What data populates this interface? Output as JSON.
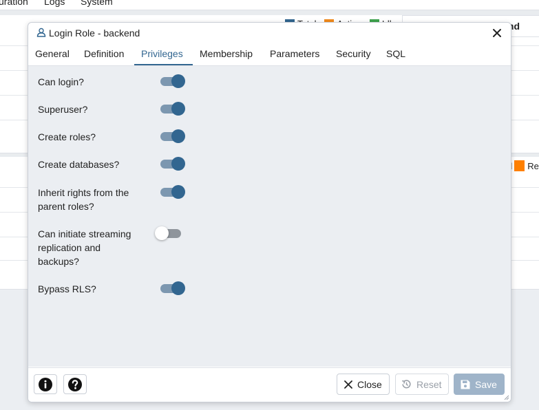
{
  "background": {
    "menu": [
      "uration",
      "Logs",
      "System"
    ],
    "legend_top": [
      {
        "label": "Total",
        "color": "#326690"
      },
      {
        "label": "Active",
        "color": "#f28a1c"
      },
      {
        "label": "Idle",
        "color": "#3fa34d"
      }
    ],
    "panel_title_suffix": "nd",
    "legend_mid": [
      {
        "label": "d",
        "color": ""
      },
      {
        "label": "Re",
        "color": "#ff8000"
      }
    ]
  },
  "dialog": {
    "title": "Login Role - backend",
    "tabs": [
      "General",
      "Definition",
      "Privileges",
      "Membership",
      "Parameters",
      "Security",
      "SQL"
    ],
    "active_tab": "Privileges",
    "privileges": [
      {
        "label": "Can login?",
        "on": true
      },
      {
        "label": "Superuser?",
        "on": true
      },
      {
        "label": "Create roles?",
        "on": true
      },
      {
        "label": "Create databases?",
        "on": true
      },
      {
        "label": "Inherit rights from the parent roles?",
        "on": true
      },
      {
        "label": "Can initiate streaming replication and backups?",
        "on": false
      },
      {
        "label": "Bypass RLS?",
        "on": true
      }
    ],
    "footer": {
      "close_label": "Close",
      "reset_label": "Reset",
      "save_label": "Save"
    }
  },
  "colors": {
    "accent": "#326690",
    "toggle_on_track": "#7c97b0",
    "save_disabled": "#9fb4c9"
  }
}
